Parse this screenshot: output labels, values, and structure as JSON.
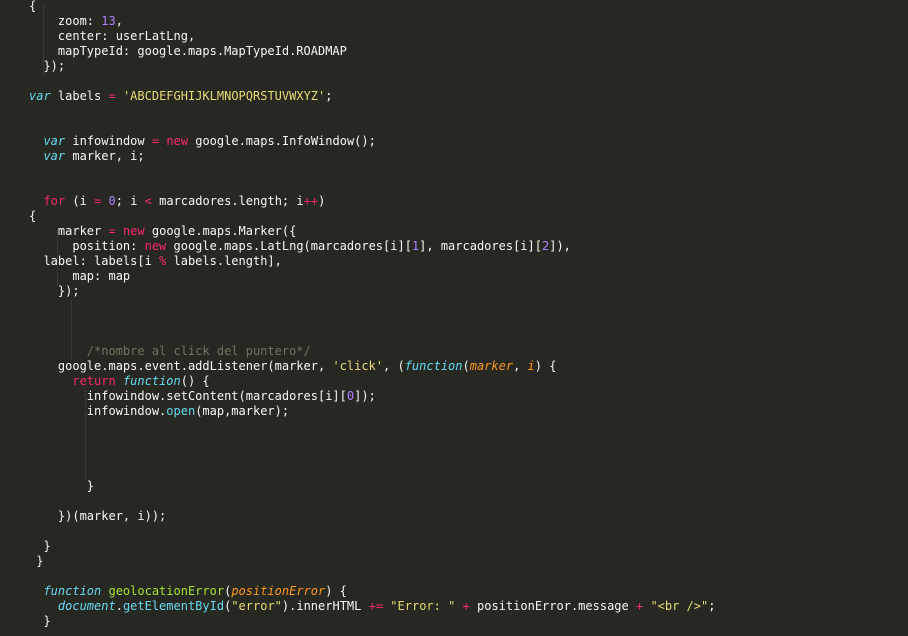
{
  "editor": {
    "theme_colors": {
      "background": "#272822",
      "text": "#f8f8f2",
      "keyword": "#f92672",
      "storage": "#66d9ef",
      "number": "#ae81ff",
      "string": "#e6db74",
      "function": "#a6e22e",
      "parameter": "#fd971f",
      "comment": "#75715e"
    },
    "lines": [
      [
        [
          "{",
          "plain"
        ]
      ],
      [
        [
          "    zoom: ",
          "plain"
        ],
        [
          "13",
          "num"
        ],
        [
          ",",
          "plain"
        ]
      ],
      [
        [
          "    center: userLatLng,",
          "plain"
        ]
      ],
      [
        [
          "    mapTypeId: google.maps.MapTypeId.ROADMAP",
          "plain"
        ]
      ],
      [
        [
          "  });",
          "plain"
        ]
      ],
      [],
      [
        [
          "var",
          "storage"
        ],
        [
          " labels ",
          "plain"
        ],
        [
          "=",
          "op"
        ],
        [
          " ",
          "plain"
        ],
        [
          "'ABCDEFGHIJKLMNOPQRSTUVWXYZ'",
          "str"
        ],
        [
          ";",
          "plain"
        ]
      ],
      [],
      [],
      [
        [
          "  ",
          "plain"
        ],
        [
          "var",
          "storage"
        ],
        [
          " infowindow ",
          "plain"
        ],
        [
          "=",
          "op"
        ],
        [
          " ",
          "plain"
        ],
        [
          "new",
          "kw"
        ],
        [
          " google.maps.InfoWindow();",
          "plain"
        ]
      ],
      [
        [
          "  ",
          "plain"
        ],
        [
          "var",
          "storage"
        ],
        [
          " marker, i;",
          "plain"
        ]
      ],
      [],
      [],
      [
        [
          "  ",
          "plain"
        ],
        [
          "for",
          "kw"
        ],
        [
          " (i ",
          "plain"
        ],
        [
          "=",
          "op"
        ],
        [
          " ",
          "plain"
        ],
        [
          "0",
          "num"
        ],
        [
          "; i ",
          "plain"
        ],
        [
          "<",
          "op"
        ],
        [
          " marcadores.length; i",
          "plain"
        ],
        [
          "++",
          "op"
        ],
        [
          ")",
          "plain"
        ]
      ],
      [
        [
          "{",
          "plain"
        ]
      ],
      [
        [
          "    marker ",
          "plain"
        ],
        [
          "=",
          "op"
        ],
        [
          " ",
          "plain"
        ],
        [
          "new",
          "kw"
        ],
        [
          " google.maps.Marker({",
          "plain"
        ]
      ],
      [
        [
          "      position: ",
          "plain"
        ],
        [
          "new",
          "kw"
        ],
        [
          " google.maps.LatLng(marcadores[i][",
          "plain"
        ],
        [
          "1",
          "num"
        ],
        [
          "], marcadores[i][",
          "plain"
        ],
        [
          "2",
          "num"
        ],
        [
          "]),",
          "plain"
        ]
      ],
      [
        [
          "  label: labels[i ",
          "plain"
        ],
        [
          "%",
          "op"
        ],
        [
          " labels.length],",
          "plain"
        ]
      ],
      [
        [
          "      map: map",
          "plain"
        ]
      ],
      [
        [
          "    });",
          "plain"
        ]
      ],
      [],
      [],
      [],
      [
        [
          "        ",
          "plain"
        ],
        [
          "/*nombre al click del puntero*/",
          "comment"
        ]
      ],
      [
        [
          "    google.maps.event.addListener(marker, ",
          "plain"
        ],
        [
          "'click'",
          "str"
        ],
        [
          ", (",
          "plain"
        ],
        [
          "function",
          "storage"
        ],
        [
          "(",
          "plain"
        ],
        [
          "marker",
          "param"
        ],
        [
          ", ",
          "plain"
        ],
        [
          "i",
          "param"
        ],
        [
          ") {",
          "plain"
        ]
      ],
      [
        [
          "      ",
          "plain"
        ],
        [
          "return",
          "kw"
        ],
        [
          " ",
          "plain"
        ],
        [
          "function",
          "storage"
        ],
        [
          "() {",
          "plain"
        ]
      ],
      [
        [
          "        infowindow.setContent(marcadores[i][",
          "plain"
        ],
        [
          "0",
          "num"
        ],
        [
          "]);",
          "plain"
        ]
      ],
      [
        [
          "        infowindow.",
          "plain"
        ],
        [
          "open",
          "prop"
        ],
        [
          "(map,marker);",
          "plain"
        ]
      ],
      [],
      [],
      [],
      [],
      [
        [
          "        }",
          "plain"
        ]
      ],
      [],
      [
        [
          "    })(marker, i));",
          "plain"
        ]
      ],
      [],
      [
        [
          "  }",
          "plain"
        ]
      ],
      [
        [
          " }",
          "plain"
        ]
      ],
      [],
      [
        [
          "  ",
          "plain"
        ],
        [
          "function",
          "storage"
        ],
        [
          " ",
          "plain"
        ],
        [
          "geolocationError",
          "fn"
        ],
        [
          "(",
          "plain"
        ],
        [
          "positionError",
          "param"
        ],
        [
          ") {",
          "plain"
        ]
      ],
      [
        [
          "    ",
          "plain"
        ],
        [
          "document",
          "builtin"
        ],
        [
          ".",
          "plain"
        ],
        [
          "getElementById",
          "prop"
        ],
        [
          "(",
          "plain"
        ],
        [
          "\"error\"",
          "str"
        ],
        [
          ").innerHTML ",
          "plain"
        ],
        [
          "+=",
          "op"
        ],
        [
          " ",
          "plain"
        ],
        [
          "\"Error: \"",
          "str"
        ],
        [
          " ",
          "plain"
        ],
        [
          "+",
          "op"
        ],
        [
          " positionError.message ",
          "plain"
        ],
        [
          "+",
          "op"
        ],
        [
          " ",
          "plain"
        ],
        [
          "\"<br />\"",
          "str"
        ],
        [
          ";",
          "plain"
        ]
      ],
      [
        [
          "  }",
          "plain"
        ]
      ]
    ]
  }
}
